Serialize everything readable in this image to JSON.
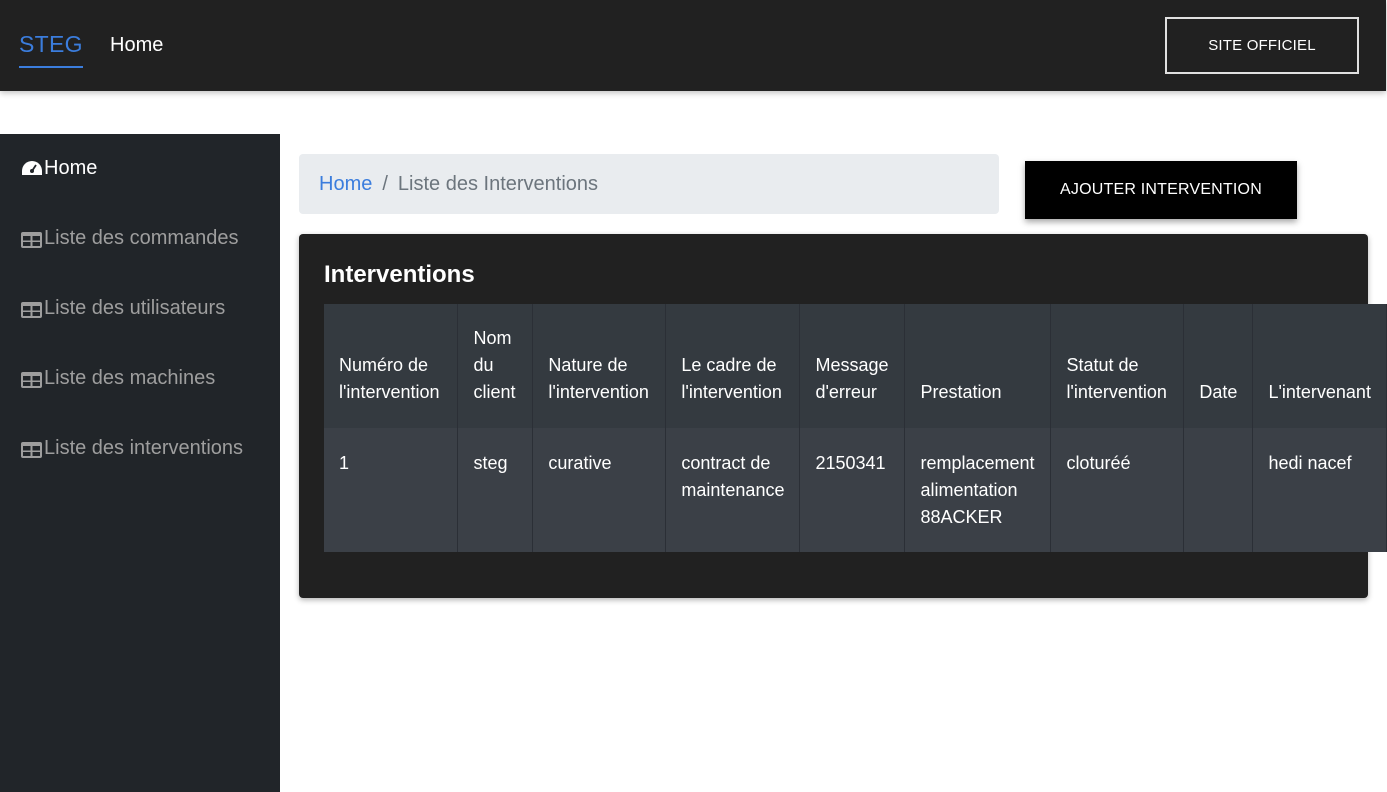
{
  "navbar": {
    "brand": "STEG",
    "home_link": "Home",
    "site_button": "SITE OFFICIEL"
  },
  "sidebar": {
    "items": [
      {
        "label": "Home",
        "icon": "dashboard-icon"
      },
      {
        "label": "Liste des commandes",
        "icon": "table-icon"
      },
      {
        "label": "Liste des utilisateurs",
        "icon": "table-icon"
      },
      {
        "label": "Liste des machines",
        "icon": "table-icon"
      },
      {
        "label": "Liste des interventions",
        "icon": "table-icon"
      }
    ]
  },
  "breadcrumb": {
    "home": "Home",
    "separator": "/",
    "current": "Liste des Interventions"
  },
  "add_button": "AJOUTER INTERVENTION",
  "card": {
    "title": "Interventions"
  },
  "table": {
    "headers": [
      [
        "Numéro de",
        "l'intervention"
      ],
      [
        "Nom",
        "du",
        "client"
      ],
      [
        "Nature de",
        "l'intervention"
      ],
      [
        "Le cadre de",
        "l'intervention"
      ],
      [
        "Message",
        "d'erreur"
      ],
      [
        "Prestation"
      ],
      [
        "Statut de",
        "l'intervention"
      ],
      [
        "Date"
      ],
      [
        "L'intervenant"
      ]
    ],
    "rows": [
      [
        [
          "1"
        ],
        [
          "steg"
        ],
        [
          "curative"
        ],
        [
          "contract de",
          "maintenance"
        ],
        [
          "2150341"
        ],
        [
          "remplacement",
          "alimentation",
          "88ACKER"
        ],
        [
          "cloturéé"
        ],
        [
          ""
        ],
        [
          "hedi nacef"
        ]
      ]
    ]
  },
  "colors": {
    "accent": "#3b7ddd",
    "navbar_bg": "#212121",
    "sidebar_bg": "#212529"
  }
}
